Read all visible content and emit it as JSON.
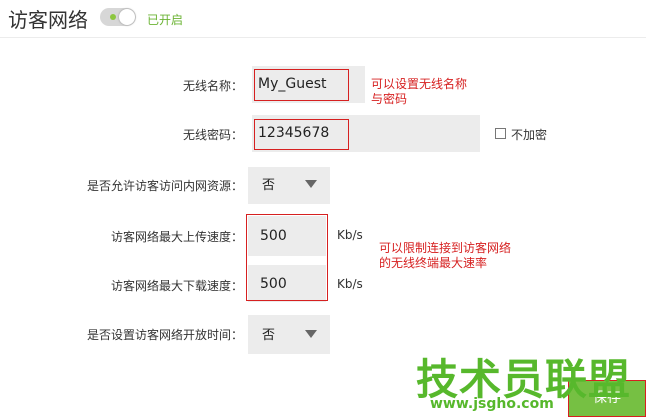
{
  "header": {
    "title": "访客网络",
    "status": "已开启",
    "toggle_on": true
  },
  "form": {
    "ssid_label": "无线名称：",
    "ssid_value": "My_Guest",
    "password_label": "无线密码：",
    "password_value": "12345678",
    "no_encrypt_label": "不加密",
    "no_encrypt_checked": false,
    "intranet_label": "是否允许访客访问内网资源：",
    "intranet_value": "否",
    "upload_label": "访客网络最大上传速度：",
    "upload_value": "500",
    "upload_unit": "Kb/s",
    "download_label": "访客网络最大下载速度：",
    "download_value": "500",
    "download_unit": "Kb/s",
    "schedule_label": "是否设置访客网络开放时间：",
    "schedule_value": "否"
  },
  "annotations": {
    "name_note_line1": "可以设置无线名称",
    "name_note_line2": "与密码",
    "speed_note_line1": "可以限制连接到访客网络",
    "speed_note_line2": "的无线终端最大速率"
  },
  "watermark": {
    "text": "技术员联盟",
    "url": "www.jsgho.com"
  },
  "footer": {
    "save_label": "保存"
  },
  "colors": {
    "accent_green": "#76c043",
    "annotation_red": "#d62020"
  }
}
